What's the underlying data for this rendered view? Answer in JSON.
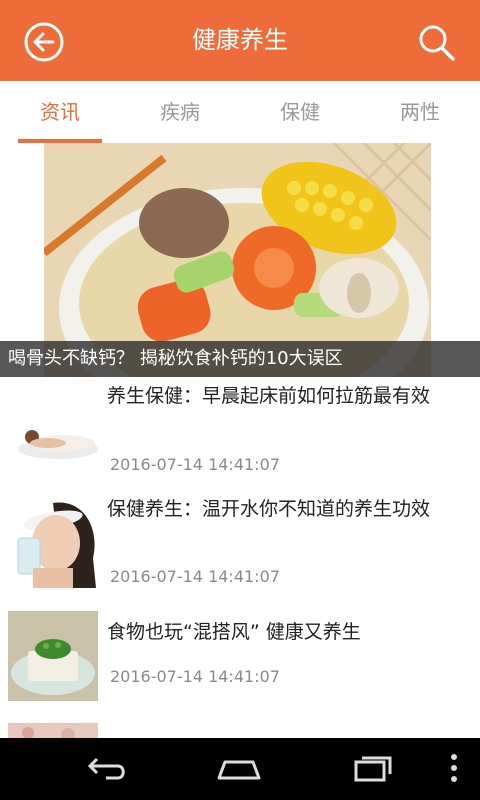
{
  "header": {
    "title": "健康养生",
    "back_icon": "back-arrow-circle-icon",
    "search_icon": "search-icon",
    "color": "#ee6b3a"
  },
  "tabs": [
    {
      "label": "资讯",
      "active": true
    },
    {
      "label": "疾病",
      "active": false
    },
    {
      "label": "保健",
      "active": false
    },
    {
      "label": "两性",
      "active": false
    }
  ],
  "featured": {
    "caption": "喝骨头不缺钙？ 揭秘饮食补钙的10大误区",
    "image": "soup-bowl-image"
  },
  "articles": [
    {
      "title": "养生保健：早晨起床前如何拉筋最有效",
      "date": "2016-07-14 14:41:07",
      "thumb": "woman-lying-thumb"
    },
    {
      "title": "保健养生：温开水你不知道的养生功效",
      "date": "2016-07-14 14:41:07",
      "thumb": "woman-drinking-thumb"
    },
    {
      "title": "食物也玩“混搭风” 健康又养生",
      "date": "2016-07-14 14:41:07",
      "thumb": "tofu-dish-thumb"
    }
  ],
  "navbar": {
    "back_icon": "nav-back-icon",
    "home_icon": "nav-home-icon",
    "recents_icon": "nav-recents-icon",
    "menu_icon": "nav-menu-icon"
  }
}
